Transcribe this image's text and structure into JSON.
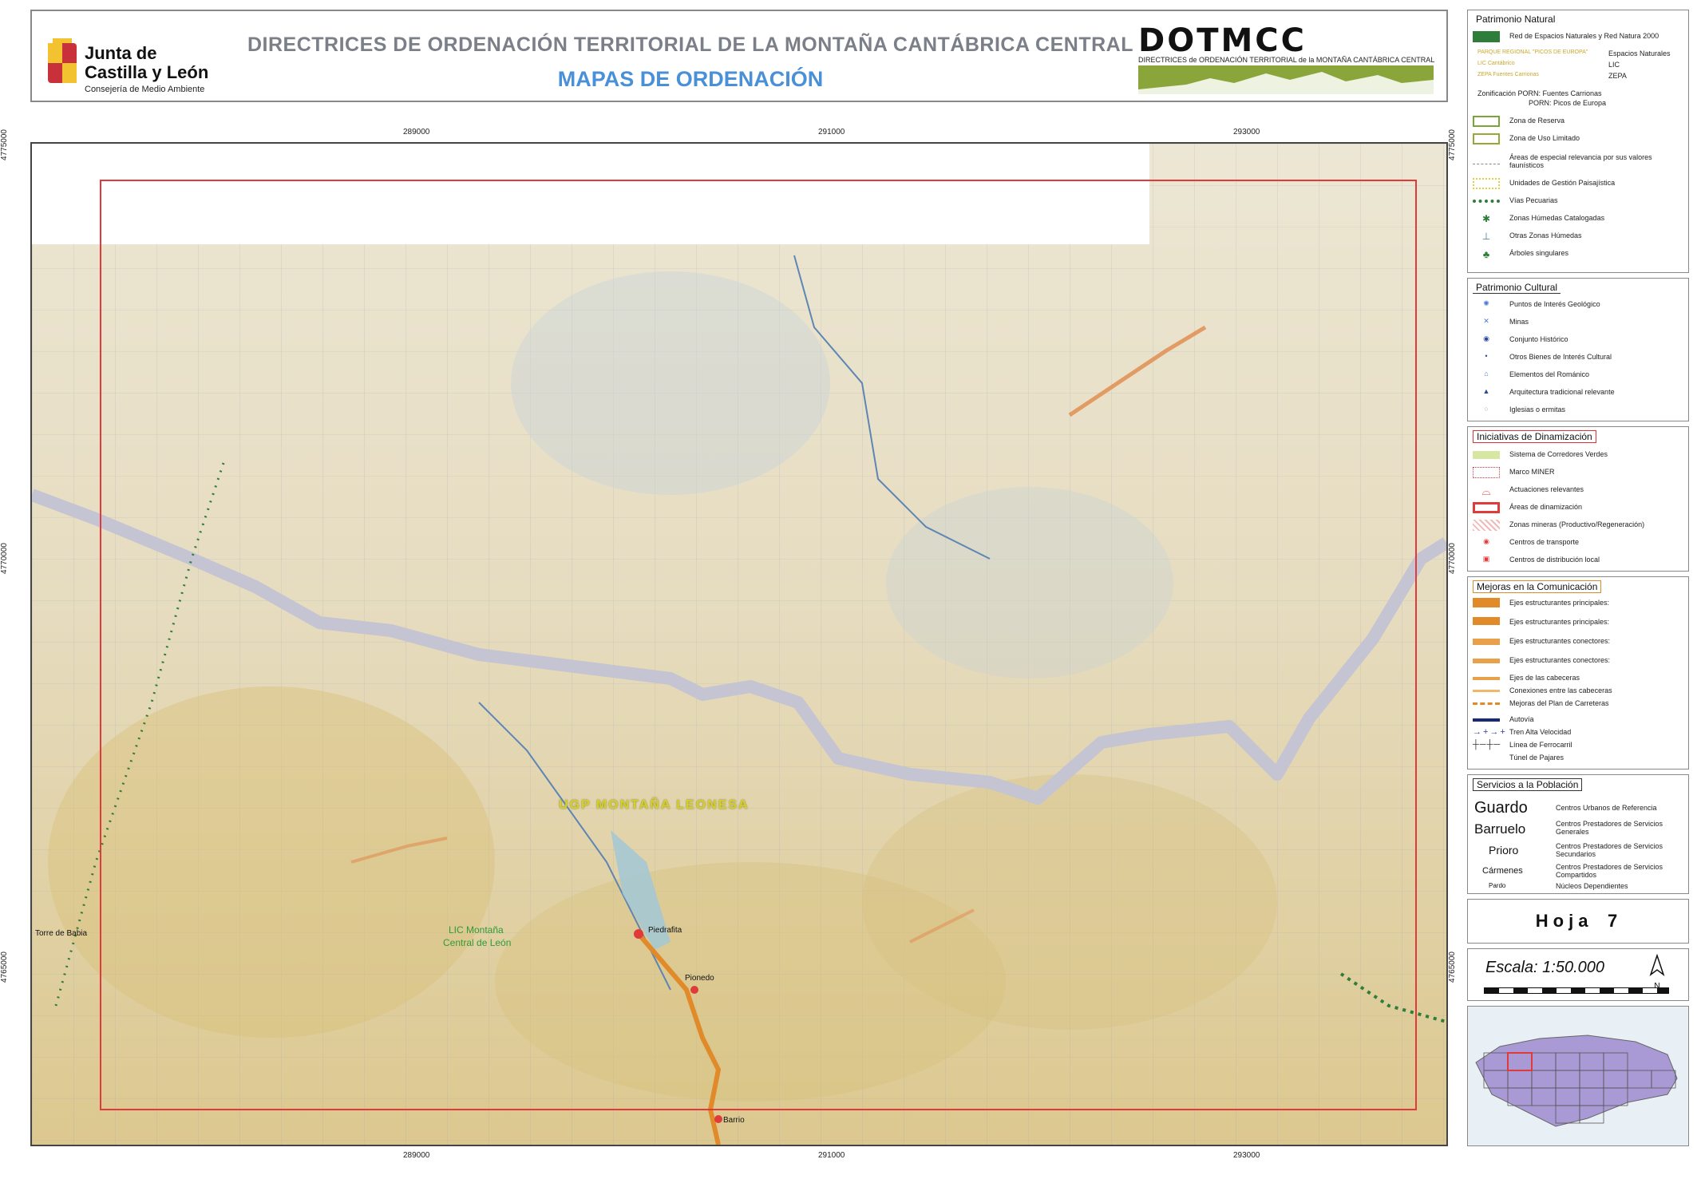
{
  "header": {
    "org_line1": "Junta de",
    "org_line2": "Castilla y León",
    "org_line3": "Consejería de Medio Ambiente",
    "title": "DIRECTRICES DE ORDENACIÓN TERRITORIAL DE LA MONTAÑA CANTÁBRICA CENTRAL",
    "subtitle": "MAPAS DE ORDENACIÓN",
    "brand": "DOTMCC",
    "brand_sub": "DIRECTRICES de ORDENACIÓN TERRITORIAL de la MONTAÑA CANTÁBRICA CENTRAL"
  },
  "coords": {
    "top": [
      "289000",
      "291000",
      "293000"
    ],
    "bottom": [
      "289000",
      "291000",
      "293000"
    ],
    "left": [
      "4775000",
      "4770000",
      "4765000"
    ],
    "right": [
      "4775000",
      "4770000",
      "4765000"
    ]
  },
  "map_labels": {
    "ugp": "UGP  MONTAÑA  LEONESA",
    "lic_line1": "LIC Montaña",
    "lic_line2": "Central de León",
    "towns": [
      "Piedrafita",
      "Pionedo",
      "Barrio",
      "Torre de Babia"
    ]
  },
  "legend": {
    "natural": {
      "title": "Patrimonio Natural",
      "items": [
        "Red de Espacios Naturales y Red Natura 2000",
        "PARQUE REGIONAL \"PICOS DE EUROPA\"",
        "LIC Cantábrico",
        "ZEPA Fuentes Carrionas",
        "Espacios Naturales",
        "LIC",
        "ZEPA",
        "Zonificación   PORN: Fuentes Carrionas",
        "PORN: Picos de Europa",
        "Zona de Reserva",
        "Zona de Uso Limitado",
        "Áreas de especial relevancia por sus valores faunísticos",
        "Unidades de Gestión Paisajística",
        "Vías Pecuarias",
        "Zonas Húmedas Catalogadas",
        "Otras Zonas Húmedas",
        "Árboles singulares"
      ]
    },
    "cultural": {
      "title": "Patrimonio Cultural",
      "items": [
        "Puntos de Interés Geológico",
        "Minas",
        "Conjunto Histórico",
        "Otros Bienes de Interés Cultural",
        "Elementos del Románico",
        "Arquitectura tradicional relevante",
        "Iglesias o ermitas"
      ]
    },
    "dinamizacion": {
      "title": "Iniciativas de Dinamización",
      "items": [
        "Sistema de Corredores Verdes",
        "Marco MINER",
        "Actuaciones relevantes",
        "Áreas de dinamización",
        "Zonas mineras (Productivo/Regeneración)",
        "Centros de transporte",
        "Centros de distribución local"
      ]
    },
    "comunicacion": {
      "title": "Mejoras en la Comunicación",
      "items": [
        "Ejes estructurantes principales:",
        "Ejes estructurantes principales:",
        "Ejes estructurantes conectores:",
        "Ejes estructurantes conectores:",
        "Ejes de las cabeceras",
        "Conexiones entre las cabeceras",
        "Mejoras del Plan de Carreteras",
        "Autovía",
        "Tren Alta Velocidad",
        "Línea de Ferrocarril",
        "Túnel de Pajares"
      ]
    },
    "servicios": {
      "title": "Servicios a la Población",
      "items": [
        {
          "name": "Guardo",
          "label": "Centros Urbanos de Referencia"
        },
        {
          "name": "Barruelo",
          "label": "Centros Prestadores de Servicios Generales"
        },
        {
          "name": "Prioro",
          "label": "Centros Prestadores de Servicios Secundarios"
        },
        {
          "name": "Cármenes",
          "label": "Centros Prestadores de Servicios Compartidos"
        },
        {
          "name": "Pardo",
          "label": "Núcleos Dependientes"
        }
      ]
    },
    "hoja_label": "Hoja",
    "hoja_number": "7",
    "escala": "Escala: 1:50.000",
    "north": "N"
  },
  "colors": {
    "terrain": "#e8dfc5",
    "border_band": "#c9c9d6",
    "red_frame": "#e03a3a",
    "road": "#e08a2a",
    "green_dots": "#2f7d3a",
    "title_blue": "#4a90d9"
  }
}
